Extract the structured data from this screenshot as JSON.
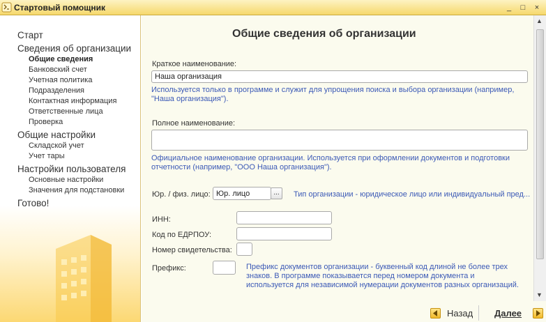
{
  "window": {
    "title": "Стартовый помощник",
    "controls": {
      "minimize": "_",
      "maximize": "□",
      "close": "×"
    }
  },
  "sidebar": {
    "items": [
      {
        "label": "Старт",
        "level": 1,
        "active": false
      },
      {
        "label": "Сведения об организации",
        "level": 1,
        "active": false
      },
      {
        "label": "Общие сведения",
        "level": 2,
        "active": true
      },
      {
        "label": "Банковский счет",
        "level": 2,
        "active": false
      },
      {
        "label": "Учетная политика",
        "level": 2,
        "active": false
      },
      {
        "label": "Подразделения",
        "level": 2,
        "active": false
      },
      {
        "label": "Контактная информация",
        "level": 2,
        "active": false
      },
      {
        "label": "Ответственные лица",
        "level": 2,
        "active": false
      },
      {
        "label": "Проверка",
        "level": 2,
        "active": false
      },
      {
        "label": "Общие настройки",
        "level": 1,
        "active": false
      },
      {
        "label": "Складской учет",
        "level": 2,
        "active": false
      },
      {
        "label": "Учет тары",
        "level": 2,
        "active": false
      },
      {
        "label": "Настройки пользователя",
        "level": 1,
        "active": false
      },
      {
        "label": "Основные настройки",
        "level": 2,
        "active": false
      },
      {
        "label": "Значения для подстановки",
        "level": 2,
        "active": false
      },
      {
        "label": "Готово!",
        "level": 1,
        "active": false
      }
    ]
  },
  "main": {
    "heading": "Общие сведения об организации",
    "short_name": {
      "label": "Краткое наименование:",
      "value": "Наша организация",
      "hint": "Используется только в программе и служит для упрощения поиска и выбора организации (например, \"Наша организация\")."
    },
    "full_name": {
      "label": "Полное наименование:",
      "value": "",
      "hint": "Официальное наименование организации. Используется при оформлении документов и подготовки отчетности (например, \"ООО Наша организация\")."
    },
    "entity_type": {
      "label": "Юр. / физ. лицо:",
      "value": "Юр. лицо",
      "button": "...",
      "hint": "Тип организации - юридическое лицо или индивидуальный пред..."
    },
    "inn": {
      "label": "ИНН:",
      "value": ""
    },
    "edrpou": {
      "label": "Код по ЕДРПОУ:",
      "value": ""
    },
    "certificate": {
      "label": "Номер свидетельства:",
      "value": ""
    },
    "prefix": {
      "label": "Префикс:",
      "value": "",
      "hint": "Префикс документов организации - буквенный код длиной не более трех знаков. В программе показывается перед номером документа и используется для независимой нумерации документов разных организаций."
    }
  },
  "footer": {
    "back_label": "Назад",
    "next_label": "Далее"
  },
  "colors": {
    "accent": "#f6d86c",
    "hint": "#3b59b6",
    "panel": "#fbfbee"
  }
}
